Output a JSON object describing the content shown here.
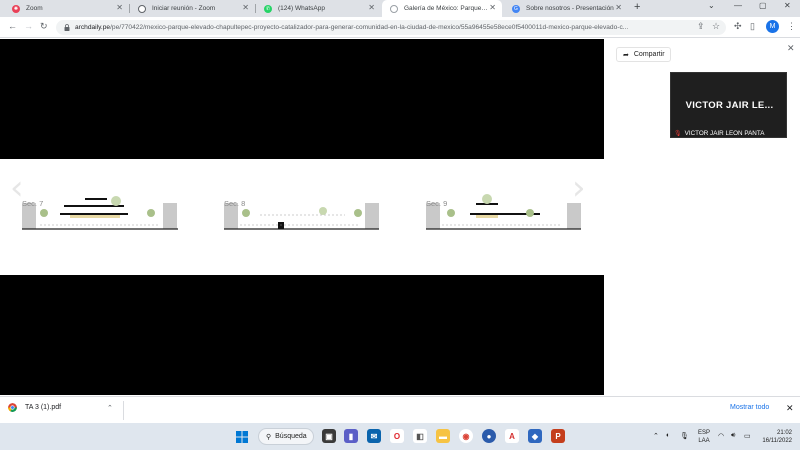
{
  "browser": {
    "tabs": [
      {
        "title": "Zoom",
        "active": false,
        "favicon": "zoom-icon",
        "color": "#e94057"
      },
      {
        "title": "Iniciar reunión - Zoom",
        "active": false,
        "favicon": "globe-icon",
        "color": "#5f6368"
      },
      {
        "title": "(124) WhatsApp",
        "active": false,
        "favicon": "whatsapp-icon",
        "color": "#25d366"
      },
      {
        "title": "Galería de México: Parque Elevad",
        "active": true,
        "favicon": "archdaily-icon",
        "color": "#9aa0a6"
      },
      {
        "title": "Sobre nosotros - Presentación",
        "active": false,
        "favicon": "google-icon",
        "color": "#4285f4"
      }
    ],
    "url_host": "archdaily.pe",
    "url_path": "/pe/770422/mexico-parque-elevado-chapultepec-proyecto-catalizador-para-generar-comunidad-en-la-ciudad-de-mexico/55a96455e58ece0f5400011d-mexico-parque-elevado-c...",
    "profile_initial": "M",
    "accent": "#1a73e8"
  },
  "viewer": {
    "sections": [
      "Sec. 7",
      "Sec. 8",
      "Sec. 9"
    ]
  },
  "side_panel": {
    "share_label": "Compartir",
    "zoom_name": "VICTOR JAIR LE...",
    "zoom_full_name": "VICTOR JAIR LEON PANTA"
  },
  "download": {
    "filename": "TA 3 (1).pdf",
    "show_all": "Mostrar todo"
  },
  "taskbar": {
    "search_label": "Búsqueda",
    "lang_top": "ESP",
    "lang_bottom": "LAA",
    "time": "21:02",
    "date": "16/11/2022"
  }
}
